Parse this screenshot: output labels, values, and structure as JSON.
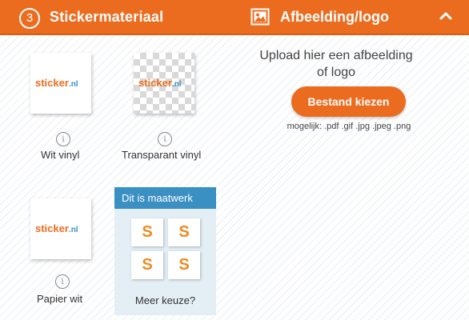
{
  "header": {
    "step_number": "3",
    "step_title": "Stickermateriaal",
    "upload_title": "Afbeelding/logo"
  },
  "materials": [
    {
      "name": "Wit vinyl",
      "logo_main": "sticker",
      "logo_tld": ".nl",
      "info": "i"
    },
    {
      "name": "Transparant vinyl",
      "logo_main": "sticker",
      "logo_tld": ".nl",
      "info": "i"
    },
    {
      "name": "Papier wit",
      "logo_main": "sticker",
      "logo_tld": ".nl",
      "info": "i"
    }
  ],
  "maatwerk": {
    "header": "Dit is maatwerk",
    "tiles": [
      "S",
      "S",
      "S",
      "S"
    ],
    "label": "Meer keuze?"
  },
  "upload": {
    "instruction": "Upload hier een afbeelding of logo",
    "button_label": "Bestand kiezen",
    "formats": "mogelijk: .pdf .gif .jpg .jpeg .png"
  },
  "colors": {
    "accent": "#ec6c1f",
    "blue": "#3a8fc3"
  }
}
